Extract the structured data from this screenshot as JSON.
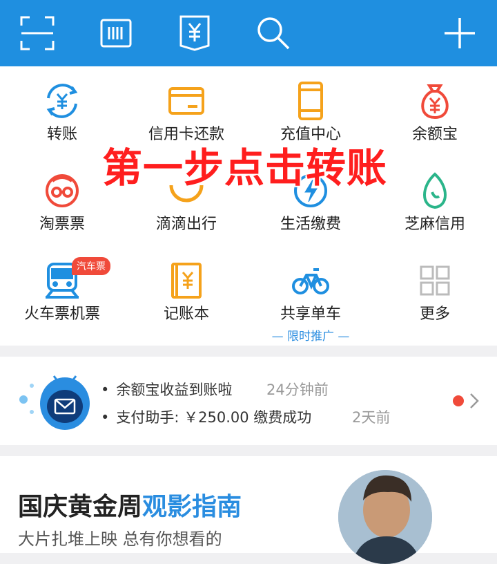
{
  "topbar": {
    "icons": [
      "scan-icon",
      "barcode-icon",
      "receive-money-icon",
      "search-icon",
      "add-icon"
    ],
    "color": "#1f8fe0"
  },
  "grid": {
    "items": [
      {
        "label": "转账",
        "icon": "transfer-icon"
      },
      {
        "label": "信用卡还款",
        "icon": "credit-card-icon"
      },
      {
        "label": "充值中心",
        "icon": "phone-recharge-icon"
      },
      {
        "label": "余额宝",
        "icon": "money-bag-icon"
      },
      {
        "label": "淘票票",
        "icon": "taopiaopiao-icon"
      },
      {
        "label": "滴滴出行",
        "icon": "didi-icon"
      },
      {
        "label": "生活缴费",
        "icon": "lightning-icon"
      },
      {
        "label": "芝麻信用",
        "icon": "sesame-icon"
      },
      {
        "label": "火车票机票",
        "icon": "train-icon"
      },
      {
        "label": "记账本",
        "icon": "ledger-icon"
      },
      {
        "label": "共享单车",
        "icon": "bicycle-icon"
      },
      {
        "label": "更多",
        "icon": "more-grid-icon"
      }
    ],
    "badge": "汽车票",
    "promo_sub": "— 限时推广 —"
  },
  "overlay_text": "第一步点击转账",
  "notice": {
    "items": [
      {
        "text": "余额宝收益到账啦",
        "time": "24分钟前"
      },
      {
        "text": "支付助手: ￥250.00 缴费成功",
        "time": "2天前"
      }
    ]
  },
  "card": {
    "title_main": "国庆黄金周",
    "title_highlight": "观影指南",
    "subtitle": "大片扎堆上映 总有你想看的"
  },
  "colors": {
    "accent": "#2a8de0",
    "orange": "#f5a21b",
    "red": "#f04a3a"
  }
}
